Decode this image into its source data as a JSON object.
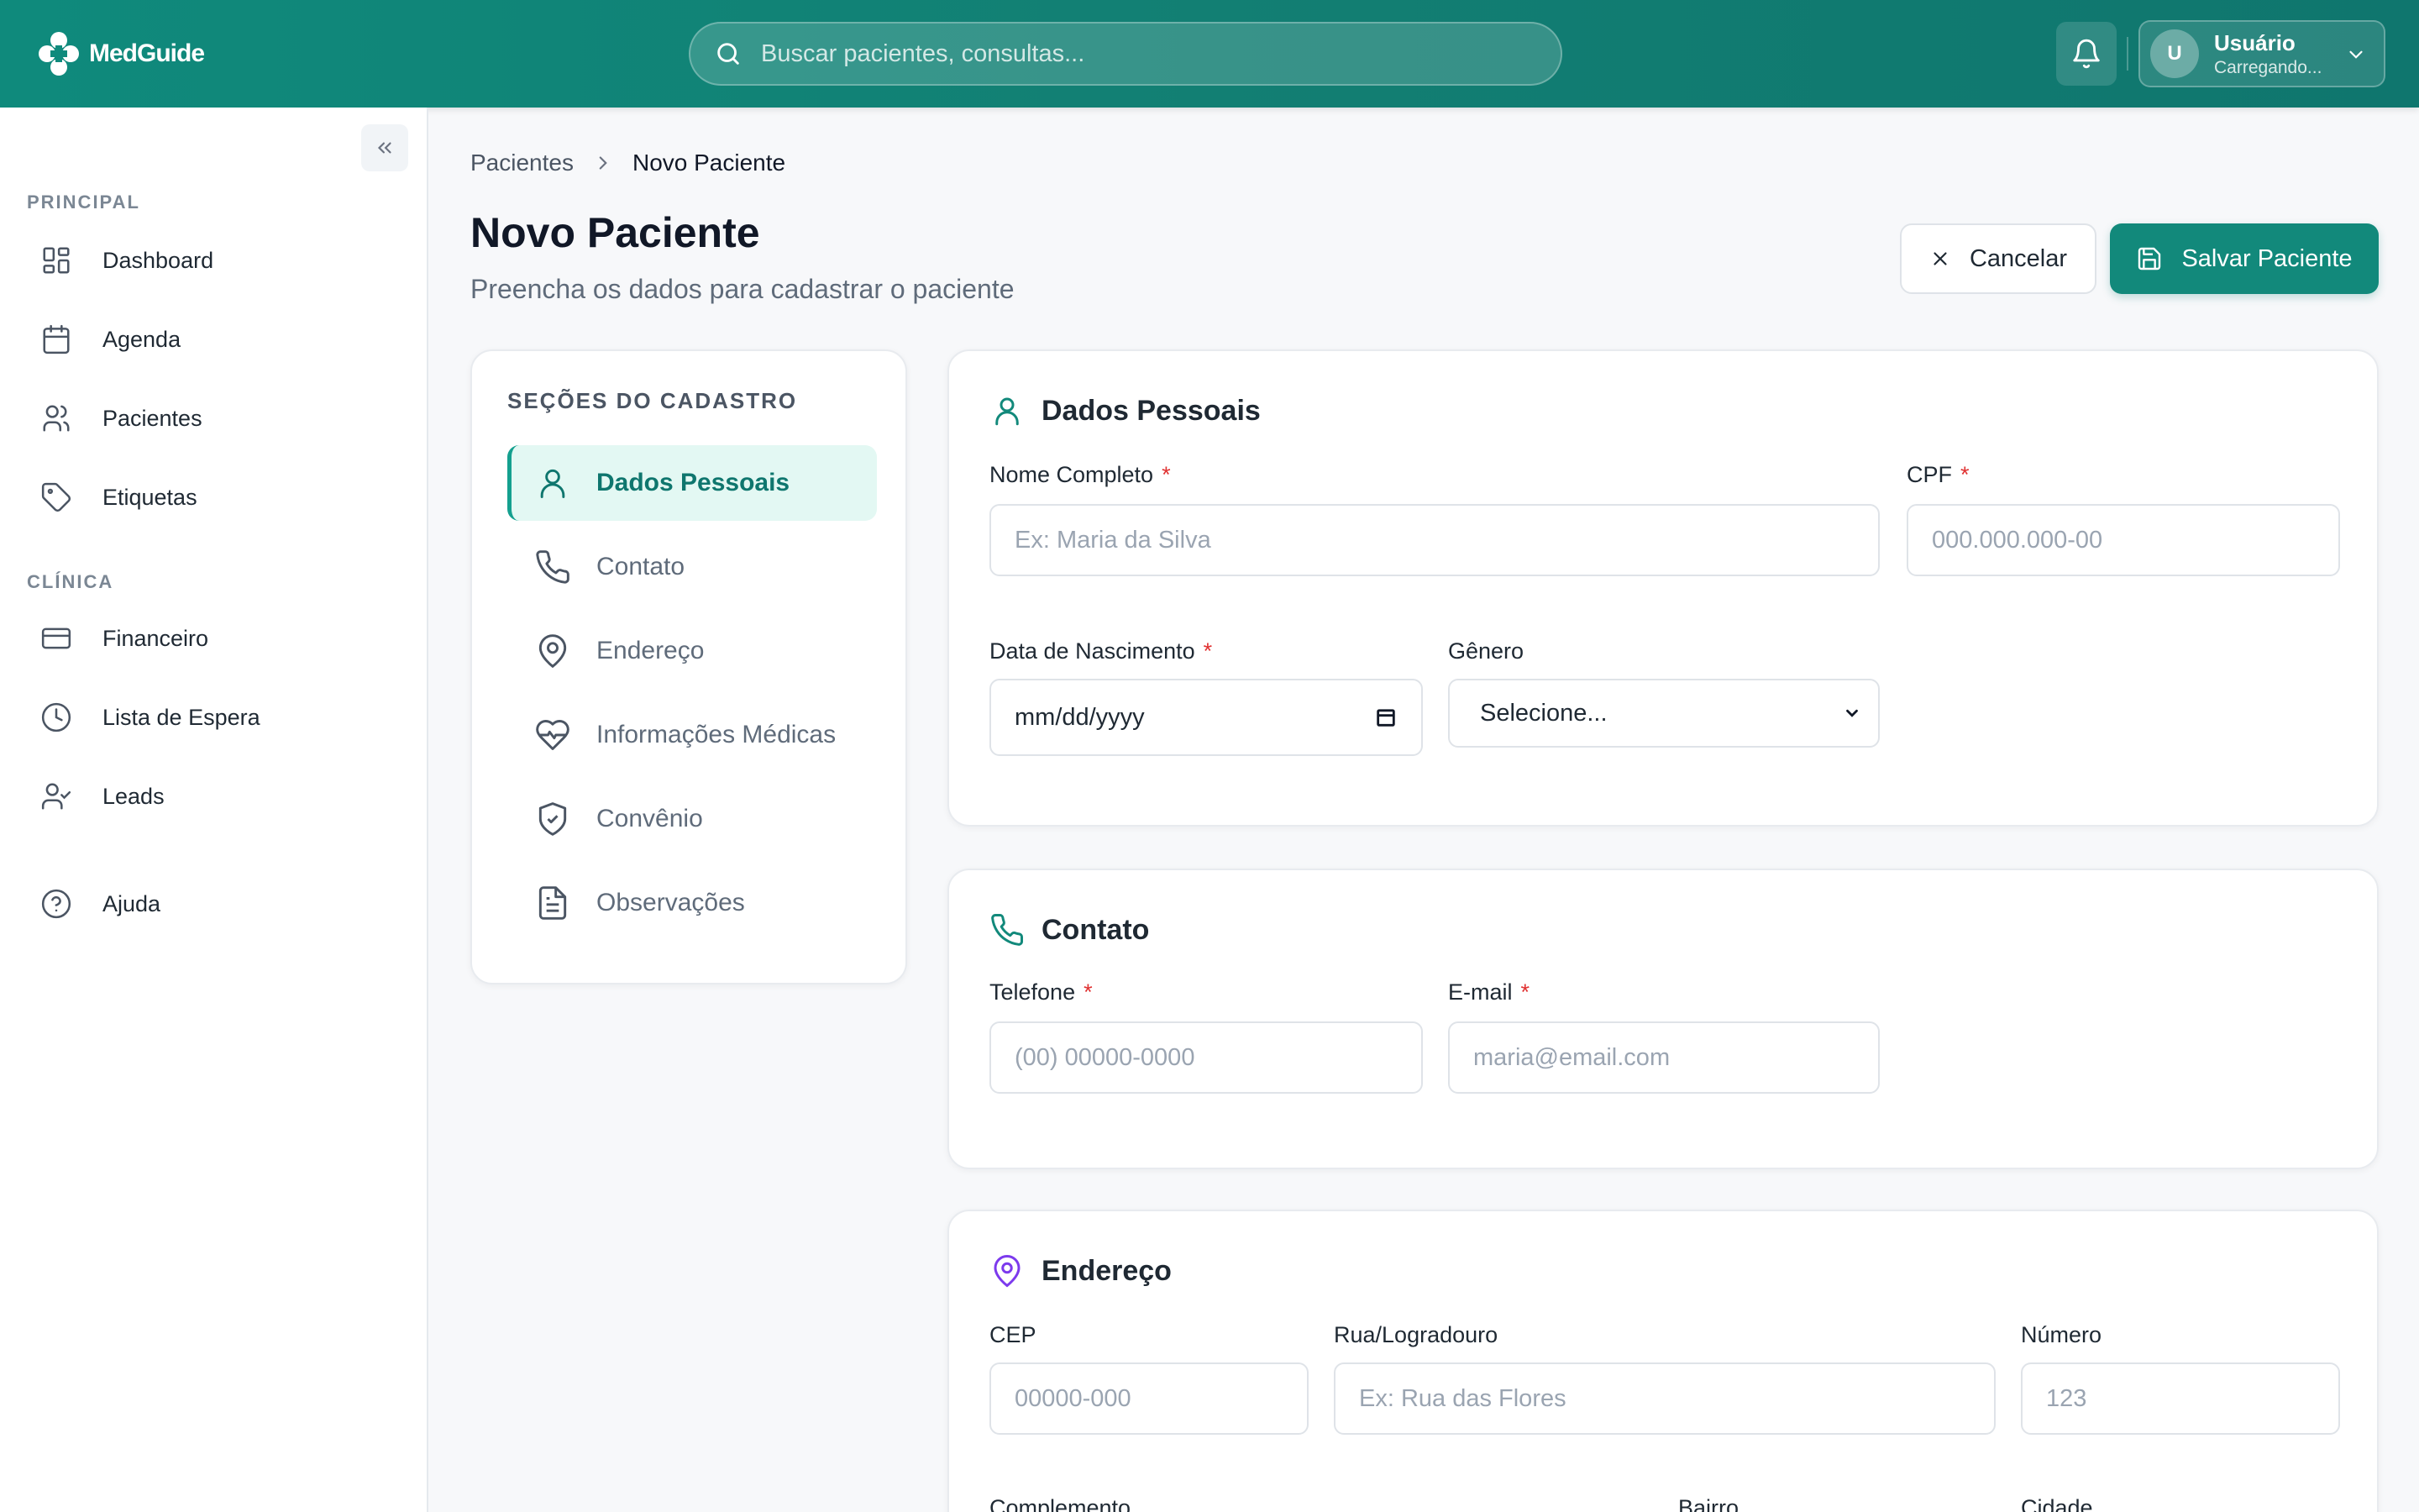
{
  "app": {
    "name": "MedGuide"
  },
  "header": {
    "search_placeholder": "Buscar pacientes, consultas...",
    "user": {
      "initial": "U",
      "name": "Usuário",
      "status": "Carregando..."
    }
  },
  "sidebar": {
    "sections": [
      {
        "label": "PRINCIPAL",
        "items": [
          {
            "label": "Dashboard",
            "icon": "layout-grid-icon"
          },
          {
            "label": "Agenda",
            "icon": "calendar-icon"
          },
          {
            "label": "Pacientes",
            "icon": "users-icon"
          },
          {
            "label": "Etiquetas",
            "icon": "tag-icon"
          }
        ]
      },
      {
        "label": "CLÍNICA",
        "items": [
          {
            "label": "Financeiro",
            "icon": "credit-card-icon"
          },
          {
            "label": "Lista de Espera",
            "icon": "clock-icon"
          },
          {
            "label": "Leads",
            "icon": "user-check-icon"
          }
        ]
      }
    ],
    "help_label": "Ajuda"
  },
  "breadcrumb": {
    "parent": "Pacientes",
    "current": "Novo Paciente"
  },
  "page": {
    "title": "Novo Paciente",
    "subtitle": "Preencha os dados para cadastrar o paciente",
    "cancel_label": "Cancelar",
    "save_label": "Salvar Paciente"
  },
  "sections_nav": {
    "title": "SEÇÕES DO CADASTRO",
    "items": [
      {
        "label": "Dados Pessoais",
        "icon": "user-icon",
        "active": true
      },
      {
        "label": "Contato",
        "icon": "phone-icon"
      },
      {
        "label": "Endereço",
        "icon": "map-pin-icon"
      },
      {
        "label": "Informações Médicas",
        "icon": "heart-pulse-icon"
      },
      {
        "label": "Convênio",
        "icon": "shield-check-icon"
      },
      {
        "label": "Observações",
        "icon": "file-text-icon"
      }
    ]
  },
  "personal": {
    "title": "Dados Pessoais",
    "name_label": "Nome Completo",
    "name_placeholder": "Ex: Maria da Silva",
    "cpf_label": "CPF",
    "cpf_placeholder": "000.000.000-00",
    "birth_label": "Data de Nascimento",
    "birth_value": "mm/dd/yyyy",
    "gender_label": "Gênero",
    "gender_value": "Selecione..."
  },
  "contact": {
    "title": "Contato",
    "phone_label": "Telefone",
    "phone_placeholder": "(00) 00000-0000",
    "email_label": "E-mail",
    "email_placeholder": "maria@email.com"
  },
  "address": {
    "title": "Endereço",
    "cep_label": "CEP",
    "cep_placeholder": "00000-000",
    "street_label": "Rua/Logradouro",
    "street_placeholder": "Ex: Rua das Flores",
    "number_label": "Número",
    "number_placeholder": "123",
    "complement_label": "Complemento",
    "district_label": "Bairro",
    "city_label": "Cidade"
  },
  "colors": {
    "primary": "#12897b",
    "accent_purple": "#7c3aed",
    "required": "#e03131"
  },
  "required_mark": "*"
}
